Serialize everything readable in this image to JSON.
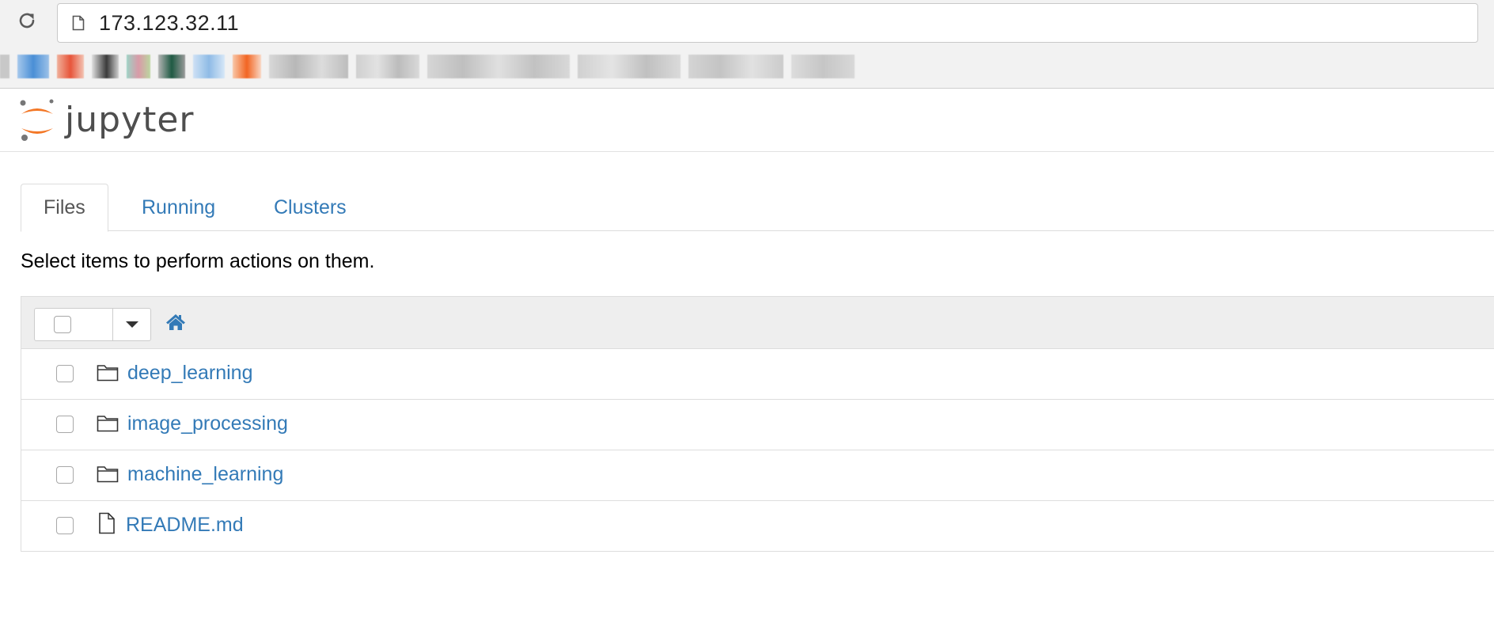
{
  "browser": {
    "url": "173.123.32.11",
    "bookmark_count": 15
  },
  "header": {
    "brand": "jupyter",
    "logo_colors": {
      "orange": "#F37726",
      "gray": "#767677"
    }
  },
  "tabs": [
    {
      "label": "Files",
      "active": true
    },
    {
      "label": "Running",
      "active": false
    },
    {
      "label": "Clusters",
      "active": false
    }
  ],
  "hint": "Select items to perform actions on them.",
  "toolbar": {
    "select_all_checked": false,
    "home_icon": "home-icon"
  },
  "files": [
    {
      "name": "deep_learning",
      "type": "folder",
      "icon": "folder-icon"
    },
    {
      "name": "image_processing",
      "type": "folder",
      "icon": "folder-icon"
    },
    {
      "name": "machine_learning",
      "type": "folder",
      "icon": "folder-icon"
    },
    {
      "name": "README.md",
      "type": "file",
      "icon": "file-icon"
    }
  ],
  "colors": {
    "link": "#337ab7",
    "panel_header_bg": "#eeeeee",
    "border": "#dddddd"
  }
}
